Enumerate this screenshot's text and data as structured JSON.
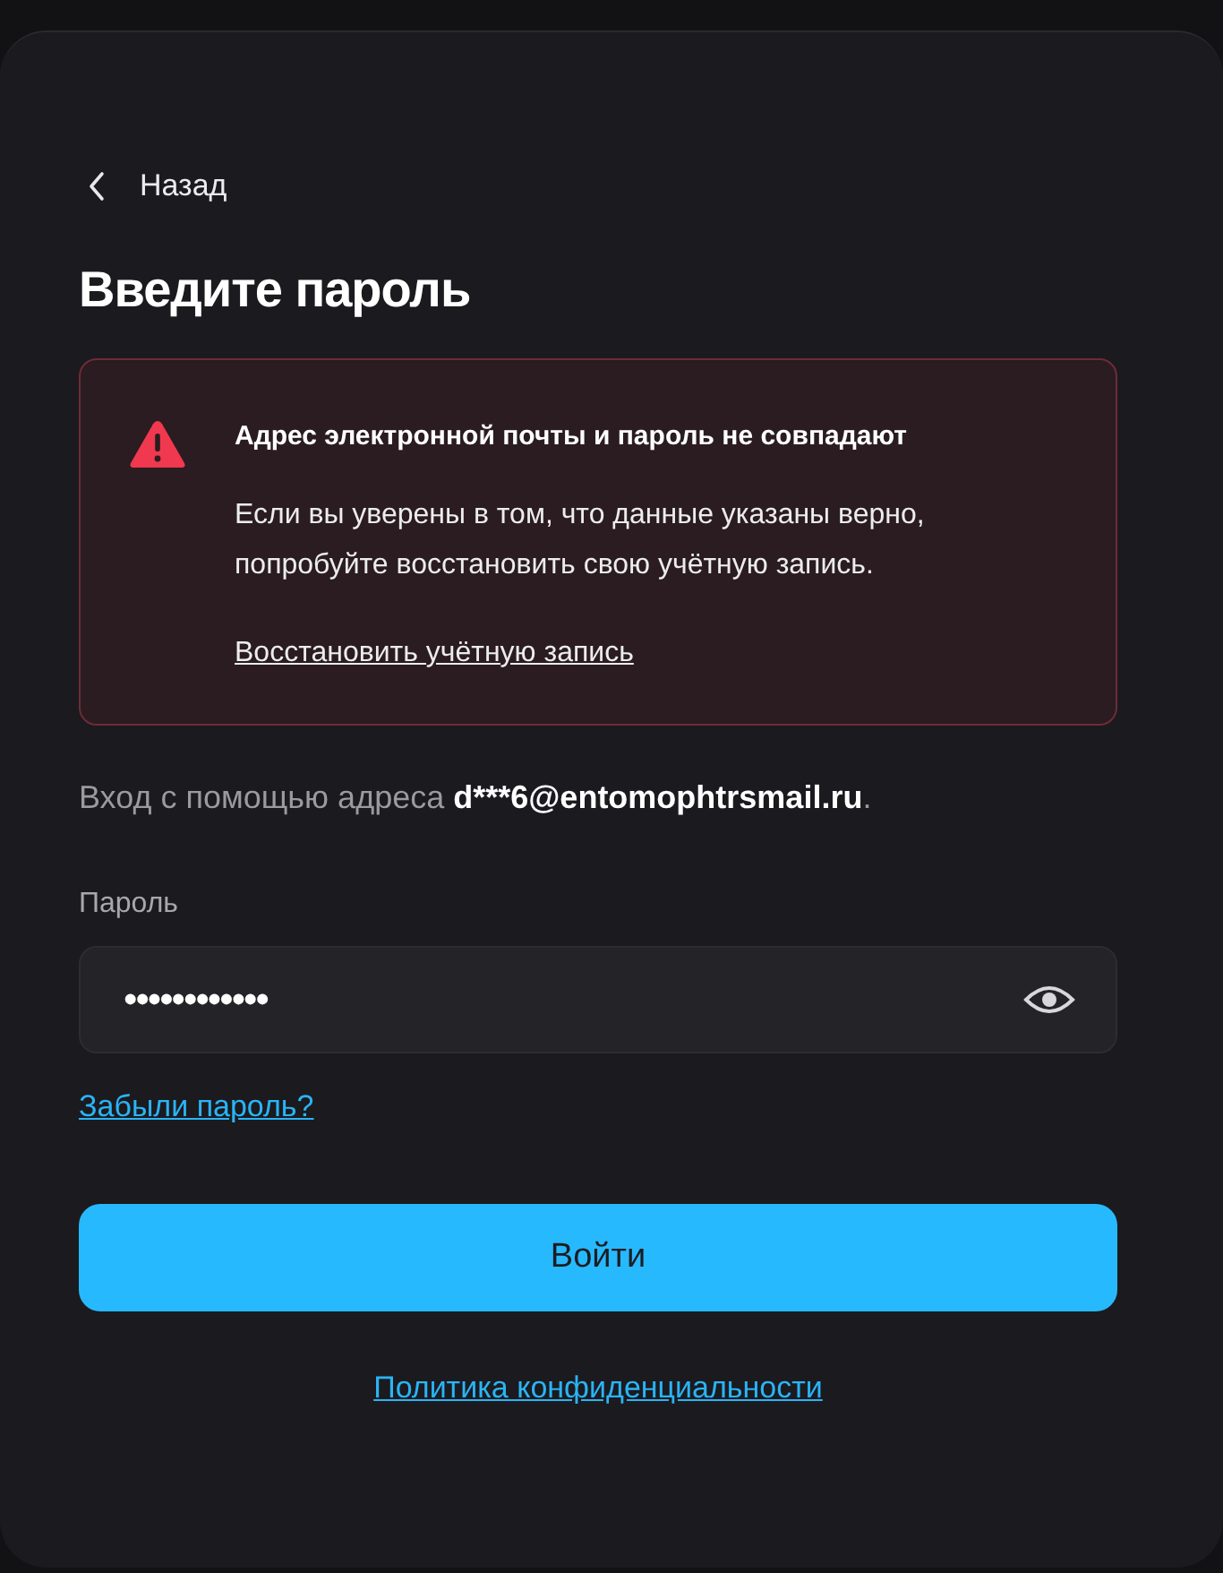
{
  "back": {
    "label": "Назад"
  },
  "title": "Введите пароль",
  "alert": {
    "title": "Адрес электронной почты и пароль не совпадают",
    "text": "Если вы уверены в том, что данные указаны верно, попробуйте восстановить свою учётную запись.",
    "link": "Восстановить учётную запись"
  },
  "login_info": {
    "prefix": "Вход с помощью адреса ",
    "email": "d***6@entomophtrsmail.ru",
    "suffix": "."
  },
  "password": {
    "label": "Пароль",
    "value": "••••••••••••"
  },
  "forgot_link": "Забыли пароль?",
  "submit": "Войти",
  "privacy_link": "Политика конфиденциальности"
}
